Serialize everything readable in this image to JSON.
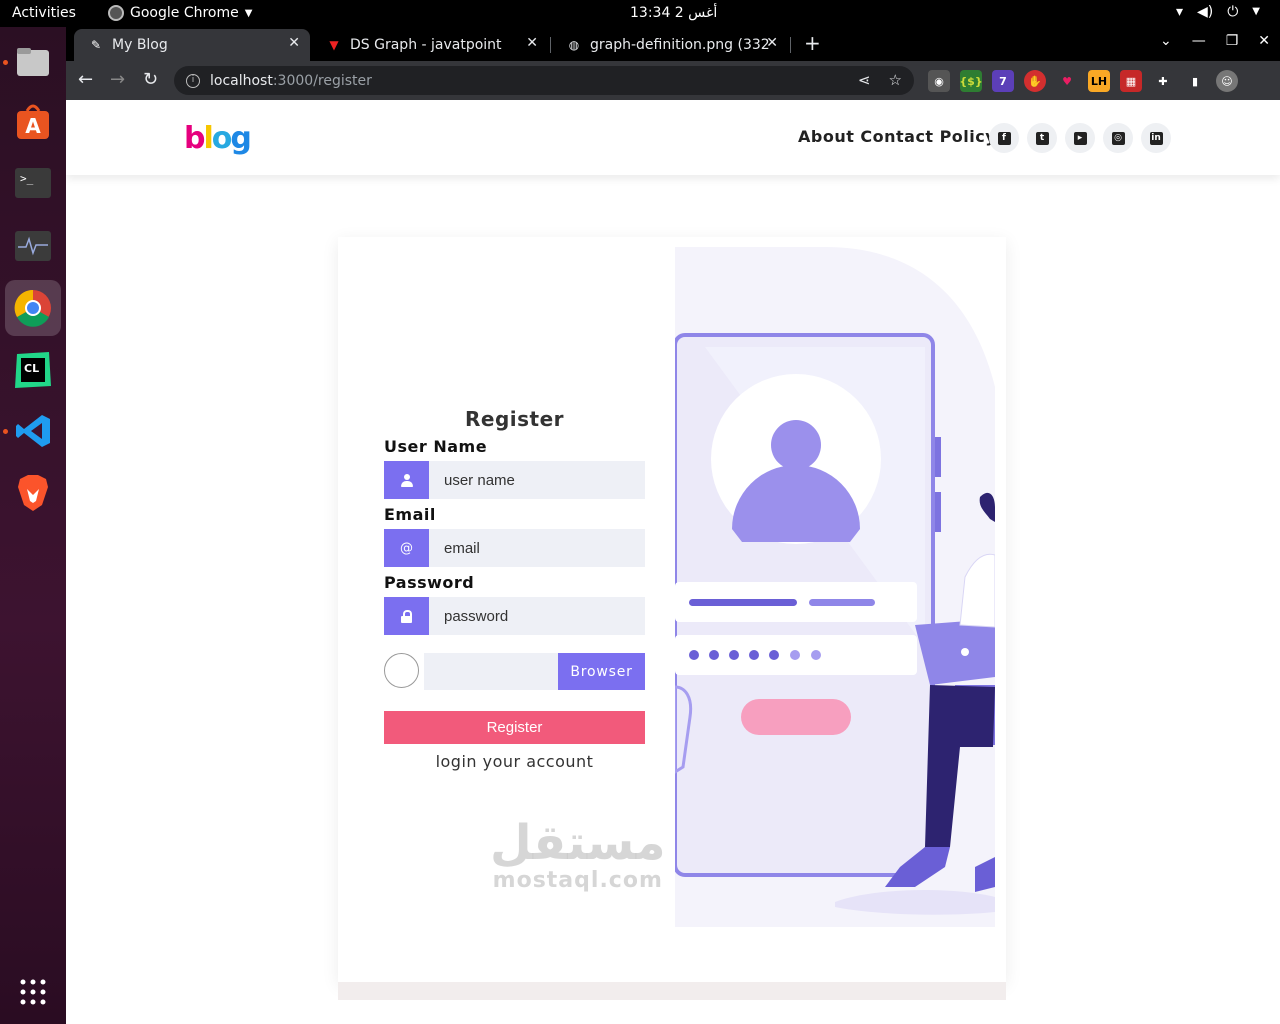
{
  "os": {
    "activities": "Activities",
    "app_name": "Google Chrome",
    "clock": "13:34  2 أغس"
  },
  "browser": {
    "tabs": [
      {
        "title": "My Blog",
        "active": true
      },
      {
        "title": "DS Graph - javatpoint",
        "active": false
      },
      {
        "title": "graph-definition.png (332",
        "active": false
      }
    ],
    "url_host": "localhost",
    "url_path": ":3000/register"
  },
  "site": {
    "logo_letters": [
      "b",
      "l",
      "o",
      "g"
    ],
    "nav": [
      "About",
      "Contact",
      "Policy"
    ],
    "social_icons": [
      "facebook-icon",
      "twitter-icon",
      "youtube-icon",
      "github-icon",
      "linkedin-icon"
    ]
  },
  "form": {
    "title": "Register",
    "username_label": "User Name",
    "username_placeholder": "user name",
    "email_label": "Email",
    "email_placeholder": "email",
    "email_icon": "@",
    "password_label": "Password",
    "password_placeholder": "password",
    "browse_label": "Browser",
    "submit_label": "Register",
    "login_link": "login your account"
  },
  "watermark": {
    "arabic": "مستقل",
    "latin": "mostaql.com"
  },
  "colors": {
    "accent": "#7b6ff0",
    "submit": "#f25a7b",
    "input_bg": "#eef0f6"
  }
}
